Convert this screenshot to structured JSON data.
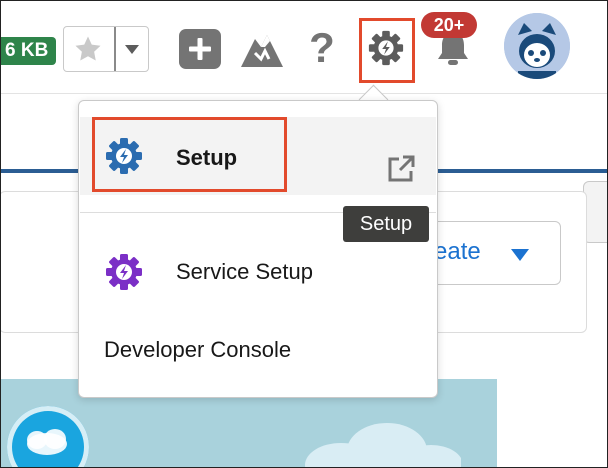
{
  "header": {
    "storage_badge": "6 KB",
    "notifications_count": "20+",
    "icons": [
      "star-icon",
      "chevron-down-icon",
      "plus-icon",
      "trailhead-icon",
      "help-icon",
      "gear-icon",
      "bell-icon",
      "avatar"
    ]
  },
  "page": {
    "create_button_label": "eate"
  },
  "dropdown": {
    "items": [
      {
        "label": "Setup",
        "icon": "gear-icon"
      },
      {
        "label": "Service Setup",
        "icon": "gear-icon"
      },
      {
        "label": "Developer Console"
      }
    ]
  },
  "tooltip": "Setup",
  "colors": {
    "highlight": "#e24a2c",
    "badge_green": "#2e844a",
    "notif_red": "#c23934",
    "setup_gear": "#2b6cb0",
    "service_gear": "#7b2fc6",
    "link_blue": "#1b72d0"
  }
}
